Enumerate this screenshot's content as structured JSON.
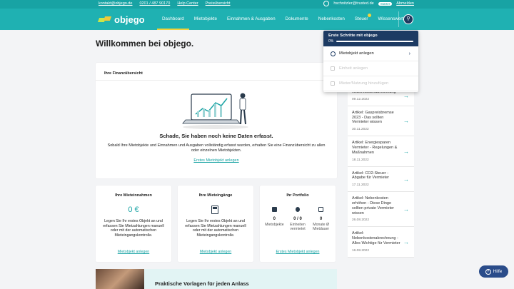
{
  "topbar": {
    "email": "kontakt@objego.de",
    "phone": "0201 / 487 90170",
    "help_center": "Help Center",
    "pricing": "Preisübersicht",
    "user_email": "hschnitzler@trusted.de",
    "badge": "Starter",
    "logout": "Abmelden"
  },
  "nav": {
    "logo": "objego",
    "items": [
      "Dashboard",
      "Mietobjekte",
      "Einnahmen & Ausgaben",
      "Dokumente",
      "Nebenkosten",
      "Steuer",
      "Wissenswertes"
    ]
  },
  "page": {
    "title": "Willkommen bei objego."
  },
  "finance": {
    "heading": "Ihre Finanzübersicht",
    "title": "Schade, Sie haben noch keine Daten erfasst.",
    "text": "Sobald Ihre Mietobjekte und Einnahmen und Ausgaben vollständig erfasst wurden, erhalten Sie eine Finanzübersicht zu allen oder einzelnen Mietobjekten.",
    "link": "Erstes Mietobjekt anlegen"
  },
  "cards": {
    "income": {
      "heading": "Ihre Mieteinnahmen",
      "value": "0 €",
      "text": "Legen Sie Ihr erstes Objekt an und erfassen Sie Mietzahlungen manuell oder mit der automatischen Mieteingangskontrolle.",
      "link": "Mietobjekt anlegen"
    },
    "receipts": {
      "heading": "Ihre Mieteingänge",
      "text": "Legen Sie Ihr erstes Objekt an und erfassen Sie Mietzahlungen manuell oder mit der automatischen Mieteingangskontrolle.",
      "link": "Mietobjekt anlegen"
    },
    "portfolio": {
      "heading": "Ihr Portfolio",
      "stats": [
        {
          "value": "0",
          "label": "Mietobjekte"
        },
        {
          "value": "0 / 0",
          "label": "Einheiten vermietet"
        },
        {
          "value": "0",
          "label": "Monate Ø Mietdauer"
        }
      ],
      "link": "Erstes Mietobjekt anlegen"
    }
  },
  "banner": {
    "title": "Praktische Vorlagen für jeden Anlass"
  },
  "articles": [
    {
      "title": "Nebenkostenabrechnung",
      "date": "09.12.2022"
    },
    {
      "title": "Artikel: Gaspreisbremse 2023 - Das sollten Vermieter wissen",
      "date": "30.11.2022"
    },
    {
      "title": "Artikel: Energiesparen Vermieter - Regelungen & Maßnahmen",
      "date": "18.11.2022"
    },
    {
      "title": "Artikel: CO2-Steuer - Abgabe für Vermieter",
      "date": "17.11.2022"
    },
    {
      "title": "Artikel: Nebenkosten erhöhen - Diese Dinge sollten private Vermieter wissen",
      "date": "26.08.2022"
    },
    {
      "title": "Artikel: Nebenkostenabrechnung - Alles Wichtige für Vermieter",
      "date": "16.08.2022"
    }
  ],
  "steps": {
    "title": "Erste Schritte mit objego",
    "progress": "0%",
    "progress_value": 0,
    "items": [
      {
        "label": "Mietobjekt anlegen",
        "enabled": true
      },
      {
        "label": "Einheit anlegen",
        "enabled": false
      },
      {
        "label": "Mieter/Nutzung hinzufügen",
        "enabled": false
      }
    ]
  },
  "help": {
    "label": "Hilfe"
  },
  "colors": {
    "teal": "#1fb1b2",
    "navy": "#1d3b63",
    "accent": "#f0d23a"
  }
}
